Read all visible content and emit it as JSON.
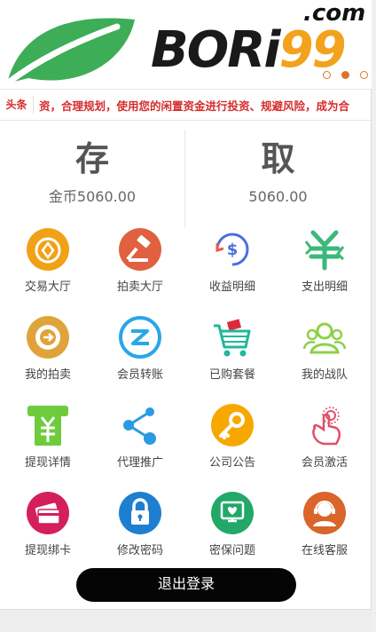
{
  "banner": {
    "brand_main": "BORi",
    "brand_num": "99",
    "brand_suffix": ".com",
    "slides": 3,
    "active_slide": 2
  },
  "ticker": {
    "tag": "头条",
    "text": "资，合理规划，使用您的闲置资金进行投资、规避风险，成为合"
  },
  "account": {
    "deposit_label": "存",
    "deposit_amount": "金币5060.00",
    "withdraw_label": "取",
    "withdraw_amount": "5060.00"
  },
  "menu": [
    {
      "label": "交易大厅",
      "icon": "trade-hall-icon",
      "color": "#f0a116"
    },
    {
      "label": "拍卖大厅",
      "icon": "auction-hammer-icon",
      "color": "#e0603f"
    },
    {
      "label": "收益明细",
      "icon": "income-detail-icon",
      "color": "#4a6fdc"
    },
    {
      "label": "支出明细",
      "icon": "expense-detail-icon",
      "color": "#3cb878"
    },
    {
      "label": "我的拍卖",
      "icon": "my-auction-icon",
      "color": "#e0a33a"
    },
    {
      "label": "会员转账",
      "icon": "transfer-icon",
      "color": "#2aa6e6"
    },
    {
      "label": "已购套餐",
      "icon": "cart-icon",
      "color": "#1fb89a"
    },
    {
      "label": "我的战队",
      "icon": "team-icon",
      "color": "#8dd04a"
    },
    {
      "label": "提现详情",
      "icon": "withdraw-detail-icon",
      "color": "#6ecb3c"
    },
    {
      "label": "代理推广",
      "icon": "share-icon",
      "color": "#2a9be0"
    },
    {
      "label": "公司公告",
      "icon": "announcement-key-icon",
      "color": "#f6a800"
    },
    {
      "label": "会员激活",
      "icon": "activate-touch-icon",
      "color": "#e24e6a"
    },
    {
      "label": "提现绑卡",
      "icon": "bind-card-icon",
      "color": "#d41f5a"
    },
    {
      "label": "修改密码",
      "icon": "lock-icon",
      "color": "#1e7fd0"
    },
    {
      "label": "密保问题",
      "icon": "security-question-icon",
      "color": "#22a868"
    },
    {
      "label": "在线客服",
      "icon": "customer-service-icon",
      "color": "#d9652a"
    }
  ],
  "logout_label": "退出登录"
}
